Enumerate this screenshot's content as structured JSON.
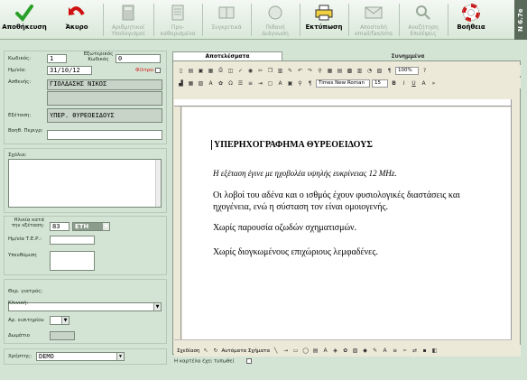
{
  "toolbar": {
    "buttons": [
      {
        "label": "Αποθήκευση",
        "icon": "green-check-icon",
        "enabled": true
      },
      {
        "label": "Άκυρο",
        "icon": "red-undo-arrow-icon",
        "enabled": true
      },
      {
        "label": "Αριθμητικοί Υπολογισμοί",
        "icon": "calculator-icon",
        "enabled": false
      },
      {
        "label": "Προ-καθορισμένα",
        "icon": "document-list-icon",
        "enabled": false
      },
      {
        "label": "Συγκριτικά",
        "icon": "compare-icon",
        "enabled": false
      },
      {
        "label": "Πιθανή Διάγνωση",
        "icon": "diagnosis-icon",
        "enabled": false
      },
      {
        "label": "Εκτύπωση",
        "icon": "printer-icon",
        "enabled": true
      },
      {
        "label": "Αποστολή email/fax/sms",
        "icon": "send-mail-icon",
        "enabled": false
      },
      {
        "label": "Αναζήτηση Επισέψεις",
        "icon": "search-visits-icon",
        "enabled": false
      },
      {
        "label": "Βοήθεια",
        "icon": "lifebuoy-icon",
        "enabled": true
      }
    ],
    "version": "N 6.7e"
  },
  "form": {
    "code_label": "Κωδικός:",
    "code_value": "1",
    "external_code_label": "Εξωτερικός Κωδικός",
    "external_code_value": "0",
    "date_label": "Ημ/νία:",
    "date_value": "31/10/12",
    "filter_label": "Φίλτρο:",
    "patient_label": "Ασθενής:",
    "patient_value": "ΓΙΟΛΔΑΣΗΣ ΝΙΚΟΣ",
    "exam_label": "Εξέταση:",
    "exam_value": "ΥΠΕΡ. ΘΥΡΕΟΕΙΔΟΥΣ",
    "assistant_label": "Βοηθ. Περιγρ:",
    "comments_label": "Σχόλια:",
    "age_label": "Ηλικία κατά την εξέταση:",
    "age_value": "83",
    "age_unit": "ΕΤΗ",
    "tep_label": "Ημ/νία Τ.Ε.Ρ.:",
    "reminder_label": "Υπενθύμιση",
    "doctor_label": "Θερ. γιατρός:",
    "clinic_label": "Κλινική:",
    "ticket_label": "Αρ. εισιτηρίου",
    "room_label": "Δωμάτιο",
    "user_label": "Χρήστης:",
    "user_value": "DEMO",
    "printed_label": "Η καρτέλα έχει τυπωθεί"
  },
  "editor": {
    "tabs": [
      {
        "label": "Αποτελέσματα",
        "active": true
      },
      {
        "label": "Συνημμένα",
        "active": false
      }
    ],
    "zoom": "100%",
    "font_name": "Times New Roman",
    "font_size": "15",
    "drawing_label": "Σχεδίαση",
    "autoshapes_label": "Αυτόματα Σχήματα",
    "document": {
      "title": "ΥΠΕΡΗΧΟΓΡΑΦΗΜΑ ΘΥΡΕΟΕΙΔΟΥΣ",
      "intro": "Η εξέταση έγινε με ηχοβολέα υψηλής ευκρίνειας 12 MHz.",
      "p1": "Οι λοβοί του αδένα και ο ισθμός έχουν φυσιολογικές διαστάσεις και ηχογένεια, ενώ η σύσταση τον είναι ομοιογενής.",
      "p2": "Χωρίς παρουσία οζωδών σχηματισμών.",
      "p3": "Χωρίς διογκωμένους επιχώριους λεμφαδένες."
    }
  },
  "colors": {
    "panel_bg": "#d4e4d4",
    "accent_green": "#28a028",
    "accent_red": "#d01010"
  }
}
